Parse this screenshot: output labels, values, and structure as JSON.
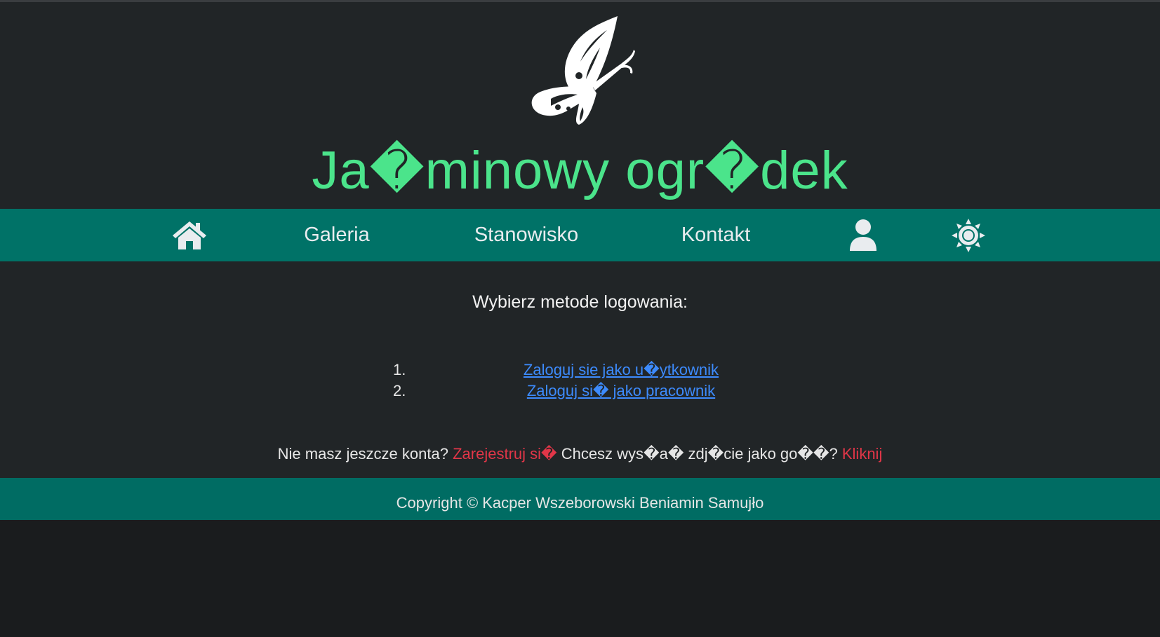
{
  "header": {
    "title": "Ja�minowy ogr�dek",
    "logo_icon": "butterfly-icon"
  },
  "nav": {
    "home_icon": "home-icon",
    "items": [
      {
        "label": "Galeria"
      },
      {
        "label": "Stanowisko"
      },
      {
        "label": "Kontakt"
      }
    ],
    "user_icon": "user-icon",
    "theme_icon": "sun-icon"
  },
  "main": {
    "heading": "Wybierz metode logowania:",
    "options": [
      {
        "number": "1.",
        "label": "Zaloguj sie jako u�ytkownik"
      },
      {
        "number": "2.",
        "label": "Zaloguj si� jako pracownik"
      }
    ],
    "register_prompt": "Nie masz jeszcze konta?",
    "register_link": "Zarejestruj si�",
    "guest_prompt": "Chcesz wys�a� zdj�cie jako go��?",
    "guest_link": "Kliknij"
  },
  "footer": {
    "copyright": "Copyright © Kacper Wszeborowski Beniamin Samujło"
  },
  "colors": {
    "background": "#212527",
    "title": "#4be48b",
    "nav": "#007267",
    "link": "#3d8bfd",
    "accent_red": "#e13648"
  }
}
